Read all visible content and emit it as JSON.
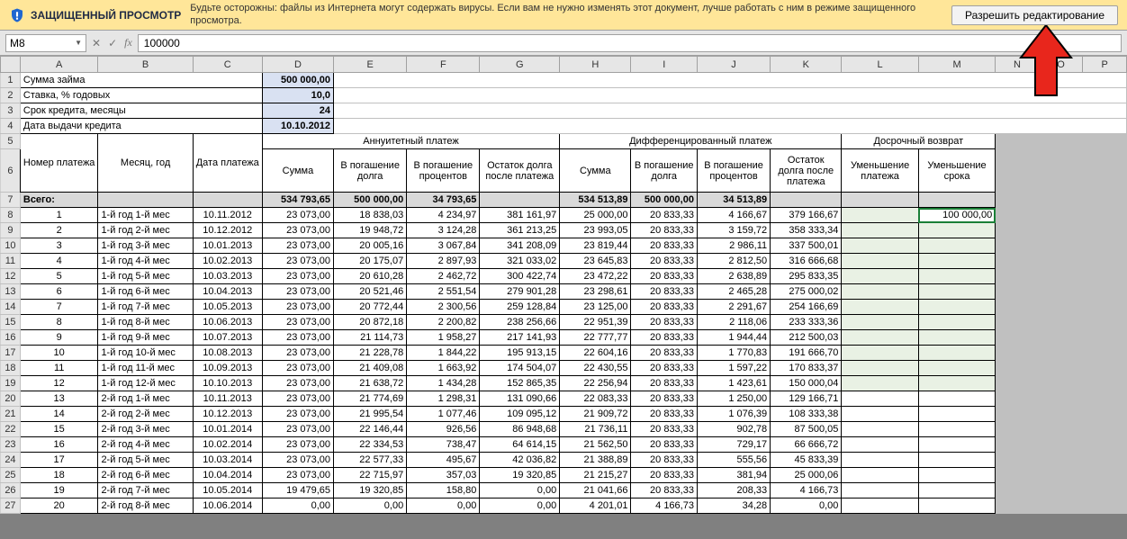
{
  "banner": {
    "title": "ЗАЩИЩЕННЫЙ ПРОСМОТР",
    "message": "Будьте осторожны: файлы из Интернета могут содержать вирусы. Если вам не нужно изменять этот документ, лучше работать с ним в режиме защищенного просмотра.",
    "enable_button": "Разрешить редактирование"
  },
  "formula_bar": {
    "namebox": "M8",
    "formula": "100000"
  },
  "column_letters": [
    "A",
    "B",
    "C",
    "D",
    "E",
    "F",
    "G",
    "H",
    "I",
    "J",
    "K",
    "L",
    "M",
    "N",
    "O",
    "P"
  ],
  "labels": {
    "row1": "Сумма займа",
    "row2": "Ставка, % годовых",
    "row3": "Срок кредита, месяцы",
    "row4": "Дата выдачи кредита",
    "values": {
      "loan_sum": "500 000,00",
      "rate": "10,0",
      "term": "24",
      "date": "10.10.2012"
    }
  },
  "headers": {
    "colA": "Номер платежа",
    "colB": "Месяц, год",
    "colC": "Дата платежа",
    "group1": "Аннуитетный платеж",
    "g1_D": "Сумма",
    "g1_E": "В погашение долга",
    "g1_F": "В погашение процентов",
    "g1_G": "Остаток долга после платежа",
    "group2": "Дифференцированный платеж",
    "g2_H": "Сумма",
    "g2_I": "В погашение долга",
    "g2_J": "В погашение процентов",
    "g2_K": "Остаток долга после платежа",
    "group3": "Досрочный возврат",
    "g3_L": "Уменьшение платежа",
    "g3_M": "Уменьшение срока"
  },
  "totals": {
    "label": "Всего:",
    "D": "534 793,65",
    "E": "500 000,00",
    "F": "34 793,65",
    "H": "534 513,89",
    "I": "500 000,00",
    "J": "34 513,89"
  },
  "rows": [
    {
      "n": "1",
      "b": "1-й год 1-й мес",
      "c": "10.11.2012",
      "d": "23 073,00",
      "e": "18 838,03",
      "f": "4 234,97",
      "g": "381 161,97",
      "h": "25 000,00",
      "i": "20 833,33",
      "j": "4 166,67",
      "k": "379 166,67",
      "m": "100 000,00"
    },
    {
      "n": "2",
      "b": "1-й год 2-й мес",
      "c": "10.12.2012",
      "d": "23 073,00",
      "e": "19 948,72",
      "f": "3 124,28",
      "g": "361 213,25",
      "h": "23 993,05",
      "i": "20 833,33",
      "j": "3 159,72",
      "k": "358 333,34"
    },
    {
      "n": "3",
      "b": "1-й год 3-й мес",
      "c": "10.01.2013",
      "d": "23 073,00",
      "e": "20 005,16",
      "f": "3 067,84",
      "g": "341 208,09",
      "h": "23 819,44",
      "i": "20 833,33",
      "j": "2 986,11",
      "k": "337 500,01"
    },
    {
      "n": "4",
      "b": "1-й год 4-й мес",
      "c": "10.02.2013",
      "d": "23 073,00",
      "e": "20 175,07",
      "f": "2 897,93",
      "g": "321 033,02",
      "h": "23 645,83",
      "i": "20 833,33",
      "j": "2 812,50",
      "k": "316 666,68"
    },
    {
      "n": "5",
      "b": "1-й год 5-й мес",
      "c": "10.03.2013",
      "d": "23 073,00",
      "e": "20 610,28",
      "f": "2 462,72",
      "g": "300 422,74",
      "h": "23 472,22",
      "i": "20 833,33",
      "j": "2 638,89",
      "k": "295 833,35"
    },
    {
      "n": "6",
      "b": "1-й год 6-й мес",
      "c": "10.04.2013",
      "d": "23 073,00",
      "e": "20 521,46",
      "f": "2 551,54",
      "g": "279 901,28",
      "h": "23 298,61",
      "i": "20 833,33",
      "j": "2 465,28",
      "k": "275 000,02"
    },
    {
      "n": "7",
      "b": "1-й год 7-й мес",
      "c": "10.05.2013",
      "d": "23 073,00",
      "e": "20 772,44",
      "f": "2 300,56",
      "g": "259 128,84",
      "h": "23 125,00",
      "i": "20 833,33",
      "j": "2 291,67",
      "k": "254 166,69"
    },
    {
      "n": "8",
      "b": "1-й год 8-й мес",
      "c": "10.06.2013",
      "d": "23 073,00",
      "e": "20 872,18",
      "f": "2 200,82",
      "g": "238 256,66",
      "h": "22 951,39",
      "i": "20 833,33",
      "j": "2 118,06",
      "k": "233 333,36"
    },
    {
      "n": "9",
      "b": "1-й год 9-й мес",
      "c": "10.07.2013",
      "d": "23 073,00",
      "e": "21 114,73",
      "f": "1 958,27",
      "g": "217 141,93",
      "h": "22 777,77",
      "i": "20 833,33",
      "j": "1 944,44",
      "k": "212 500,03"
    },
    {
      "n": "10",
      "b": "1-й год 10-й мес",
      "c": "10.08.2013",
      "d": "23 073,00",
      "e": "21 228,78",
      "f": "1 844,22",
      "g": "195 913,15",
      "h": "22 604,16",
      "i": "20 833,33",
      "j": "1 770,83",
      "k": "191 666,70"
    },
    {
      "n": "11",
      "b": "1-й год 11-й мес",
      "c": "10.09.2013",
      "d": "23 073,00",
      "e": "21 409,08",
      "f": "1 663,92",
      "g": "174 504,07",
      "h": "22 430,55",
      "i": "20 833,33",
      "j": "1 597,22",
      "k": "170 833,37"
    },
    {
      "n": "12",
      "b": "1-й год 12-й мес",
      "c": "10.10.2013",
      "d": "23 073,00",
      "e": "21 638,72",
      "f": "1 434,28",
      "g": "152 865,35",
      "h": "22 256,94",
      "i": "20 833,33",
      "j": "1 423,61",
      "k": "150 000,04"
    },
    {
      "n": "13",
      "b": "2-й год 1-й мес",
      "c": "10.11.2013",
      "d": "23 073,00",
      "e": "21 774,69",
      "f": "1 298,31",
      "g": "131 090,66",
      "h": "22 083,33",
      "i": "20 833,33",
      "j": "1 250,00",
      "k": "129 166,71"
    },
    {
      "n": "14",
      "b": "2-й год 2-й мес",
      "c": "10.12.2013",
      "d": "23 073,00",
      "e": "21 995,54",
      "f": "1 077,46",
      "g": "109 095,12",
      "h": "21 909,72",
      "i": "20 833,33",
      "j": "1 076,39",
      "k": "108 333,38"
    },
    {
      "n": "15",
      "b": "2-й год 3-й мес",
      "c": "10.01.2014",
      "d": "23 073,00",
      "e": "22 146,44",
      "f": "926,56",
      "g": "86 948,68",
      "h": "21 736,11",
      "i": "20 833,33",
      "j": "902,78",
      "k": "87 500,05"
    },
    {
      "n": "16",
      "b": "2-й год 4-й мес",
      "c": "10.02.2014",
      "d": "23 073,00",
      "e": "22 334,53",
      "f": "738,47",
      "g": "64 614,15",
      "h": "21 562,50",
      "i": "20 833,33",
      "j": "729,17",
      "k": "66 666,72"
    },
    {
      "n": "17",
      "b": "2-й год 5-й мес",
      "c": "10.03.2014",
      "d": "23 073,00",
      "e": "22 577,33",
      "f": "495,67",
      "g": "42 036,82",
      "h": "21 388,89",
      "i": "20 833,33",
      "j": "555,56",
      "k": "45 833,39"
    },
    {
      "n": "18",
      "b": "2-й год 6-й мес",
      "c": "10.04.2014",
      "d": "23 073,00",
      "e": "22 715,97",
      "f": "357,03",
      "g": "19 320,85",
      "h": "21 215,27",
      "i": "20 833,33",
      "j": "381,94",
      "k": "25 000,06"
    },
    {
      "n": "19",
      "b": "2-й год 7-й мес",
      "c": "10.05.2014",
      "d": "19 479,65",
      "e": "19 320,85",
      "f": "158,80",
      "g": "0,00",
      "h": "21 041,66",
      "i": "20 833,33",
      "j": "208,33",
      "k": "4 166,73"
    },
    {
      "n": "20",
      "b": "2-й год 8-й мес",
      "c": "10.06.2014",
      "d": "0,00",
      "e": "0,00",
      "f": "0,00",
      "g": "0,00",
      "h": "4 201,01",
      "i": "4 166,73",
      "j": "34,28",
      "k": "0,00"
    }
  ]
}
